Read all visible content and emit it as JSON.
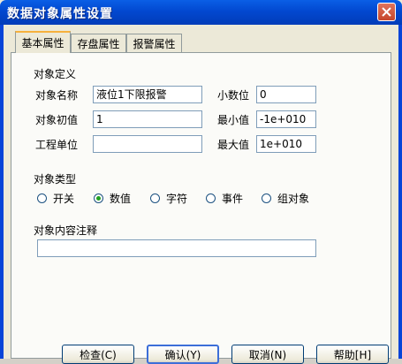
{
  "window": {
    "title": "数据对象属性设置"
  },
  "tabs": [
    {
      "label": "基本属性",
      "active": true
    },
    {
      "label": "存盘属性",
      "active": false
    },
    {
      "label": "报警属性",
      "active": false
    }
  ],
  "object_def": {
    "group_title": "对象定义",
    "name_label": "对象名称",
    "name_value": "液位1下限报警",
    "init_label": "对象初值",
    "init_value": "1",
    "unit_label": "工程单位",
    "unit_value": "",
    "decimals_label": "小数位",
    "decimals_value": "0",
    "min_label": "最小值",
    "min_value": "-1e+010",
    "max_label": "最大值",
    "max_value": "1e+010"
  },
  "object_type": {
    "group_title": "对象类型",
    "options": [
      {
        "label": "开关",
        "checked": false
      },
      {
        "label": "数值",
        "checked": true
      },
      {
        "label": "字符",
        "checked": false
      },
      {
        "label": "事件",
        "checked": false
      },
      {
        "label": "组对象",
        "checked": false
      }
    ]
  },
  "comment": {
    "group_title": "对象内容注释",
    "value": ""
  },
  "buttons": {
    "check": "检查(C)",
    "ok": "确认(Y)",
    "cancel": "取消(N)",
    "help": "帮助[H]"
  },
  "colors": {
    "title_bar": "#0248d0",
    "close_button": "#c6472c",
    "tab_highlight": "#f6b13d"
  }
}
